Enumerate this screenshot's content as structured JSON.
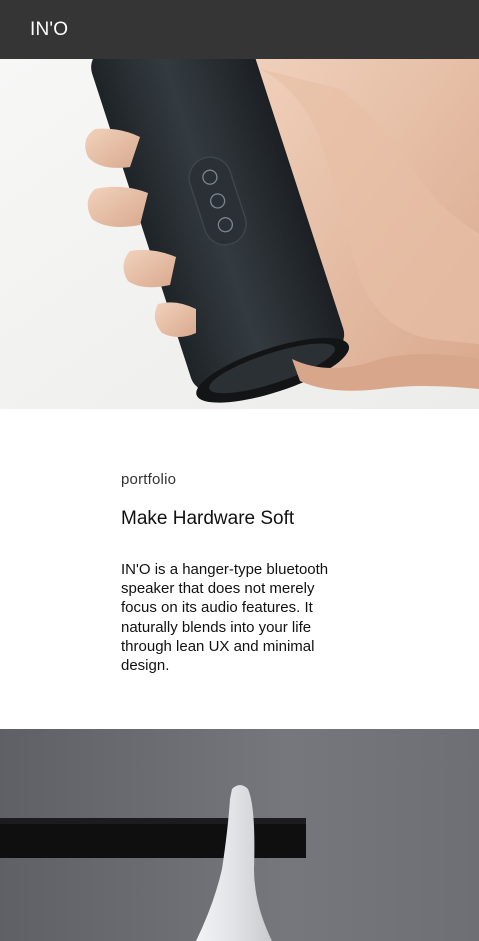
{
  "header": {
    "brand": "IN'O"
  },
  "hero": {
    "icon": "product-photo-speaker-in-hand"
  },
  "intro": {
    "eyebrow": "portfolio",
    "headline": "Make Hardware Soft",
    "description": "IN'O is a hanger-type bluetooth speaker that does not merely focus on its audio features. It naturally blends into your life through lean UX and minimal design."
  },
  "gallery": {
    "icon": "product-photo-speaker-on-rail"
  },
  "colors": {
    "header_bg": "#353535",
    "speaker_body": "#2a2f33",
    "second_bg": "#6c6d73"
  }
}
